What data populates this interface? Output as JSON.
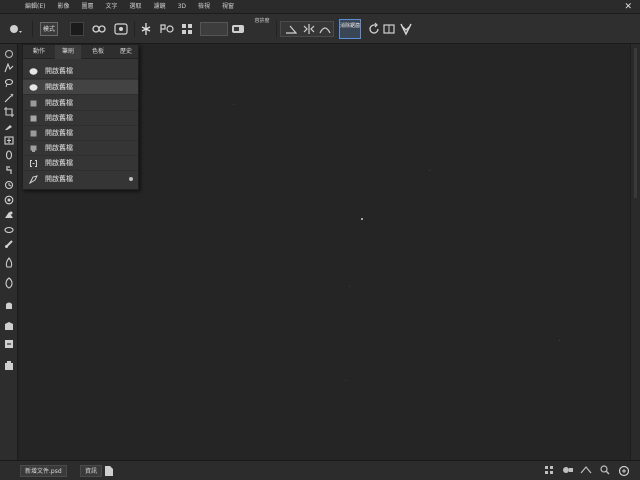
{
  "menubar": {
    "items": [
      "編輯(E)",
      "影像",
      "圖層",
      "文字",
      "選取",
      "濾鏡",
      "3D",
      "檢視",
      "視窗"
    ],
    "close_glyph": "✕"
  },
  "options": {
    "mode_label": "模式",
    "stacked_label": "容許度",
    "active_label": "消除鋸齒"
  },
  "tools": [
    "move-icon",
    "marquee-icon",
    "lasso-icon",
    "magic-wand-icon",
    "crop-icon",
    "eyedropper-icon",
    "healing-icon",
    "brush-icon",
    "clone-stamp-icon",
    "history-brush-icon",
    "eraser-icon",
    "gradient-icon",
    "blur-icon",
    "dodge-icon",
    "pen-icon",
    "type-icon",
    "path-select-icon",
    "shape-icon",
    "hand-icon",
    "zoom-icon"
  ],
  "panel": {
    "tabs": [
      "動作",
      "筆刷",
      "色板",
      "歷史"
    ],
    "rows": [
      {
        "label": "開啟舊檔",
        "icon": "circle-icon"
      },
      {
        "label": "開啟舊檔",
        "icon": "circle-icon"
      },
      {
        "label": "開啟舊檔",
        "icon": "square-icon"
      },
      {
        "label": "開啟舊檔",
        "icon": "square-icon"
      },
      {
        "label": "開啟舊檔",
        "icon": "square-icon"
      },
      {
        "label": "開啟舊檔",
        "icon": "square-icon"
      },
      {
        "label": "開啟舊檔",
        "icon": "bracket-icon"
      },
      {
        "label": "開啟舊檔",
        "icon": "brush-icon"
      }
    ]
  },
  "status": {
    "doc_tab": "新增文件.psd",
    "info_label": "資訊"
  }
}
